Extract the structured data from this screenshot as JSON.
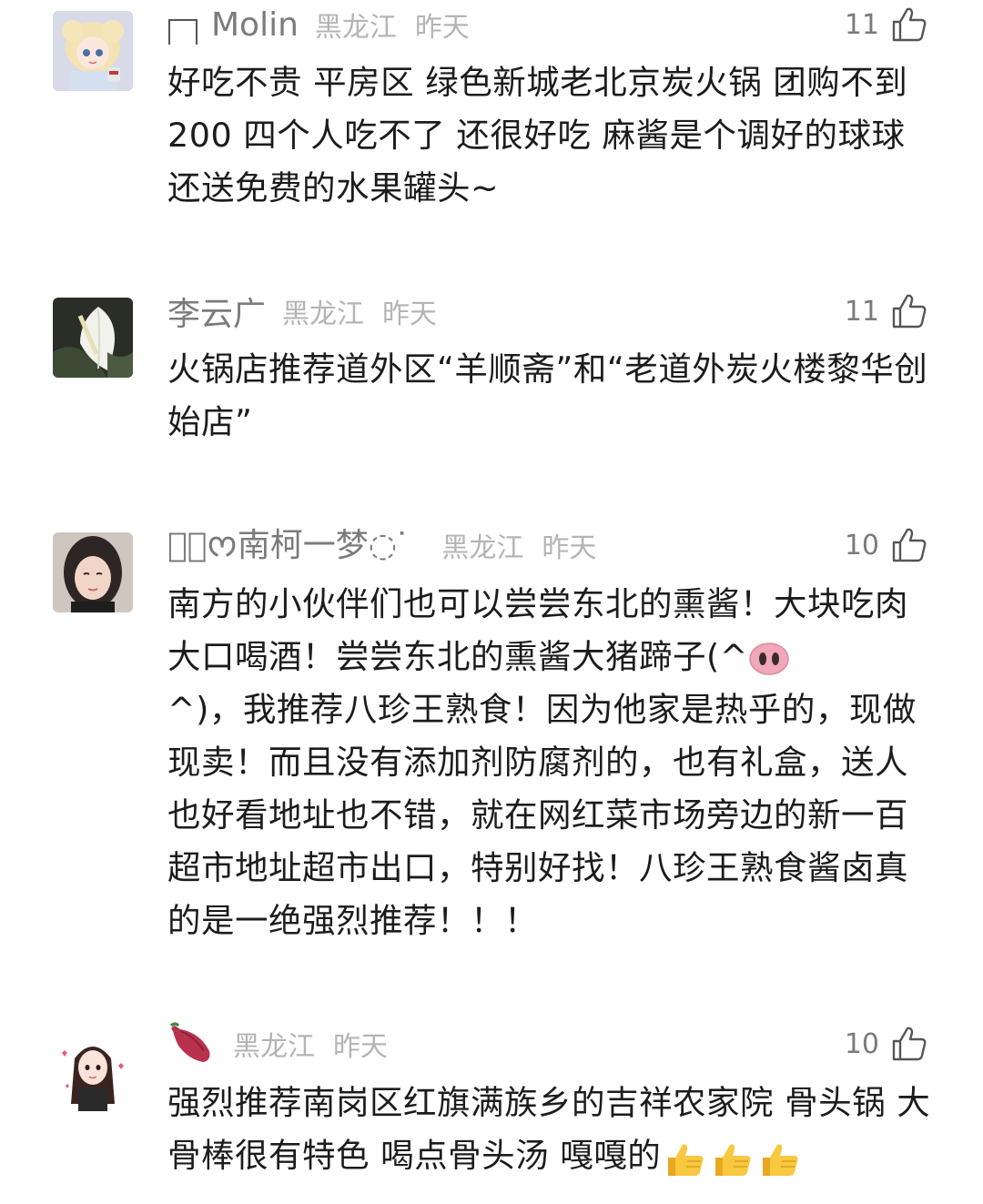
{
  "comments": [
    {
      "username": "Molin",
      "location": "黑龙江",
      "time": "昨天",
      "likes": "11",
      "text": "好吃不贵 平房区 绿色新城老北京炭火锅 团购不到200 四个人吃不了 还很好吃 麻酱是个调好的球球 还送免费的水果罐头~"
    },
    {
      "username": "李云广",
      "location": "黑龙江",
      "time": "昨天",
      "likes": "11",
      "text": "火锅店推荐道外区“羊顺斋”和“老道外炭火楼黎华创始店”"
    },
    {
      "username": "ঞ⃝ᰔ南柯一梦◌ᐝ",
      "location": "黑龙江",
      "time": "昨天",
      "likes": "10",
      "text_part1": "南方的小伙伴们也可以尝尝东北的熏酱！大块吃肉大口喝酒！尝尝东北的熏酱大猪蹄子(^",
      "text_part2": "^)，我推荐八珍王熟食！因为他家是热乎的，现做现卖！而且没有添加剂防腐剂的，也有礼盒，送人也好看地址也不错，就在网红菜市场旁边的新一百超市地址超市出口，特别好找！八珍王熟食酱卤真的是一绝强烈推荐！！！"
    },
    {
      "username": "",
      "location": "黑龙江",
      "time": "昨天",
      "likes": "10",
      "text": "强烈推荐南岗区红旗满族乡的吉祥农家院 骨头锅 大骨棒很有特色 喝点骨头汤 嘎嘎的"
    }
  ],
  "icons": {
    "like": "thumbs-up-outline-icon",
    "pig": "pig-nose-emoji",
    "thumbs": "thumbs-up-emoji",
    "sweet_potato": "sweet-potato-emoji"
  },
  "colors": {
    "username": "#7b7b7b",
    "meta": "#b4b4b4",
    "text": "#1c1c1c"
  }
}
